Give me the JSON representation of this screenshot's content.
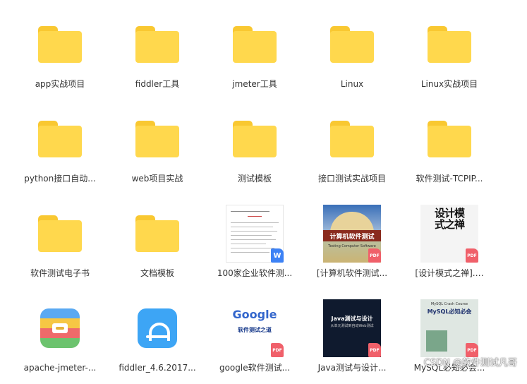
{
  "items": [
    {
      "label": "app实战项目"
    },
    {
      "label": "fiddler工具"
    },
    {
      "label": "jmeter工具"
    },
    {
      "label": "Linux"
    },
    {
      "label": "Linux实战项目"
    },
    {
      "label": "python接口自动..."
    },
    {
      "label": "web项目实战"
    },
    {
      "label": "测试模板"
    },
    {
      "label": "接口测试实战项目"
    },
    {
      "label": "软件测试-TCPIP..."
    },
    {
      "label": "软件测试电子书"
    },
    {
      "label": "文档模板"
    },
    {
      "label": "100家企业软件测...",
      "badge": "W",
      "badge_color": "#3D82F5"
    },
    {
      "label": "[计算机软件测试...",
      "badge": "PDF",
      "cover_title": "计算机软件测试",
      "cover_sub": "Testing Computer Software"
    },
    {
      "label": "[设计模式之禅].…",
      "badge": "PDF",
      "cover_title": "设计模式之禅"
    },
    {
      "label": "apache-jmeter-..."
    },
    {
      "label": "fiddler_4.6.2017..."
    },
    {
      "label": "google软件测试...",
      "badge": "PDF",
      "cover_title": "Google",
      "cover_sub": "软件测试之道"
    },
    {
      "label": "Java测试与设计...",
      "badge": "PDF",
      "cover_title": "Java测试与设计",
      "cover_sub": "从单元测试到自动Web测试"
    },
    {
      "label": "MySQL必知必会...",
      "badge": "PDF",
      "cover_title": "MySQL必知必会",
      "cover_sub": "MySQL Crash Course"
    }
  ],
  "watermark": "CSDN @软件测试凡哥",
  "colors": {
    "folder": "#FFD84D",
    "pdf_badge": "#F0606A",
    "word_badge": "#3D82F5"
  }
}
